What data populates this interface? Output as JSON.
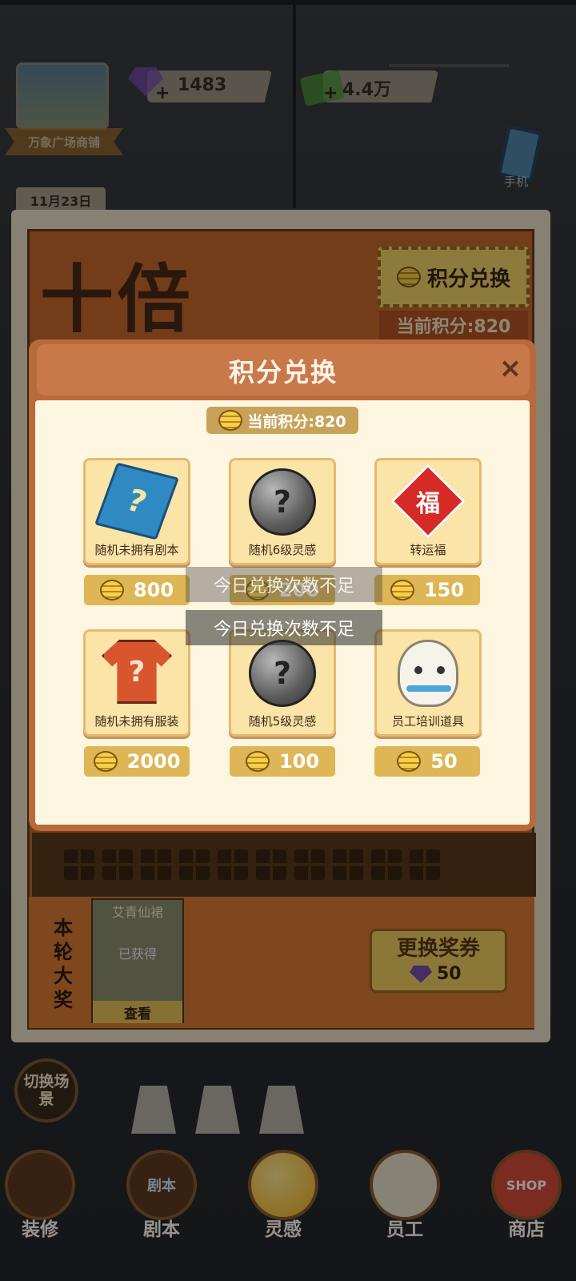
{
  "hud": {
    "shop_name": "万象广场商铺",
    "gems": "1483",
    "cash": "4.4万",
    "plus": "+",
    "phone_label": "手机",
    "date": "11月23日"
  },
  "event": {
    "big_title": "十倍",
    "exchange_button": "积分兑换",
    "current_points": "当前积分:820",
    "grand_prize_label": [
      "本",
      "轮",
      "大",
      "奖"
    ],
    "prize_name": "艾青仙裙",
    "prize_status": "已获得",
    "view_button": "查看",
    "swap_button": "更换奖券",
    "swap_cost": "50"
  },
  "modal": {
    "title": "积分兑换",
    "close": "×",
    "current_points": "当前积分:820",
    "items": [
      {
        "label": "随机未拥有剧本",
        "price": "800",
        "icon": "blue-book-question-icon"
      },
      {
        "label": "随机6级灵感",
        "price": "200",
        "icon": "gray-orb-question-icon"
      },
      {
        "label": "转运福",
        "price": "150",
        "icon": "fu-charm-icon"
      },
      {
        "label": "随机未拥有服装",
        "price": "2000",
        "icon": "red-shirt-question-icon"
      },
      {
        "label": "随机5级灵感",
        "price": "100",
        "icon": "gray-orb-question-icon"
      },
      {
        "label": "员工培训道具",
        "price": "50",
        "icon": "white-mascot-icon"
      }
    ],
    "toast": "今日兑换次数不足",
    "fu_char": "福",
    "question_mark": "?"
  },
  "nav": {
    "switch_scene": "切换场景",
    "items": [
      "装修",
      "剧本",
      "灵感",
      "员工",
      "商店"
    ],
    "book_icon_text": "剧本",
    "shop_sign": "SHOP"
  },
  "colors": {
    "modal_header": "#c9784a",
    "modal_body": "#fdf6e1",
    "price_tag": "#deb655",
    "event_orange": "#c96a2e"
  }
}
